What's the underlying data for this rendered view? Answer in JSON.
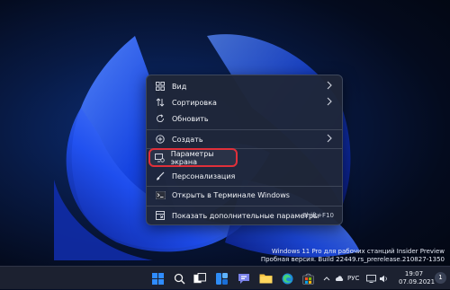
{
  "context_menu": {
    "items": [
      {
        "label": "Вид",
        "icon": "view-grid-icon",
        "submenu": true
      },
      {
        "label": "Сортировка",
        "icon": "sort-arrows-icon",
        "submenu": true
      },
      {
        "label": "Обновить",
        "icon": "refresh-icon",
        "submenu": false
      },
      {
        "label": "Создать",
        "icon": "add-circle-icon",
        "submenu": true
      },
      {
        "label": "Параметры экрана",
        "icon": "display-settings-icon",
        "submenu": false,
        "highlighted": true
      },
      {
        "label": "Персонализация",
        "icon": "brush-icon",
        "submenu": false
      },
      {
        "label": "Открыть в Терминале Windows",
        "icon": "terminal-icon",
        "submenu": false
      },
      {
        "label": "Показать дополнительные параметры",
        "icon": "more-options-icon",
        "submenu": false,
        "shortcut": "Shift+F10"
      }
    ],
    "highlight_color": "#e0303a"
  },
  "watermark": {
    "line1": "Windows 11 Pro для рабочих станций Insider Preview",
    "line2": "Пробная версия. Build 22449.rs_prerelease.210827-1350"
  },
  "taskbar": {
    "apps": [
      "start-icon",
      "search-icon",
      "task-view-icon",
      "widgets-icon",
      "teams-chat-icon",
      "file-explorer-icon",
      "edge-icon",
      "store-icon"
    ],
    "tray": {
      "language": "РУС",
      "time": "19:07",
      "date": "07.09.2021",
      "notifications": "1"
    }
  },
  "colors": {
    "menu_bg": "#1f2638",
    "taskbar_bg": "#1c2130",
    "accent_blue": "#1d5bff"
  }
}
